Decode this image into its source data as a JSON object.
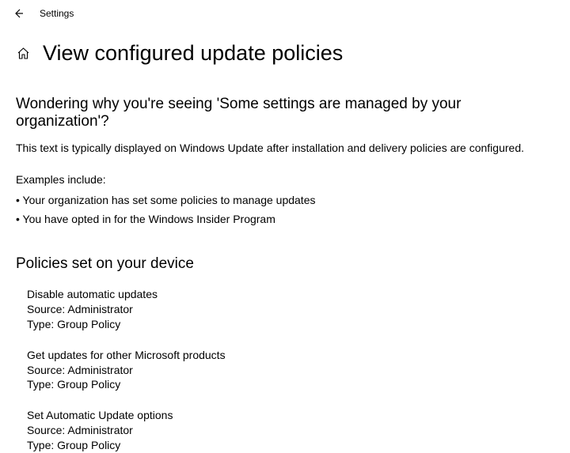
{
  "header": {
    "title": "Settings"
  },
  "page": {
    "title": "View configured update policies"
  },
  "intro": {
    "heading": "Wondering why you're seeing 'Some settings are managed by your organization'?",
    "description": "This text is typically displayed on Windows Update after installation and delivery policies are configured.",
    "examples_label": "Examples include:",
    "examples": [
      "Your organization has set some policies to manage updates",
      "You have opted in for the Windows Insider Program"
    ]
  },
  "policies": {
    "heading": "Policies set on your device",
    "list": [
      {
        "name": "Disable automatic updates",
        "source_label": "Source:",
        "source": "Administrator",
        "type_label": "Type:",
        "type": "Group Policy"
      },
      {
        "name": "Get updates for other Microsoft products",
        "source_label": "Source:",
        "source": "Administrator",
        "type_label": "Type:",
        "type": "Group Policy"
      },
      {
        "name": "Set Automatic Update options",
        "source_label": "Source:",
        "source": "Administrator",
        "type_label": "Type:",
        "type": "Group Policy"
      }
    ]
  }
}
